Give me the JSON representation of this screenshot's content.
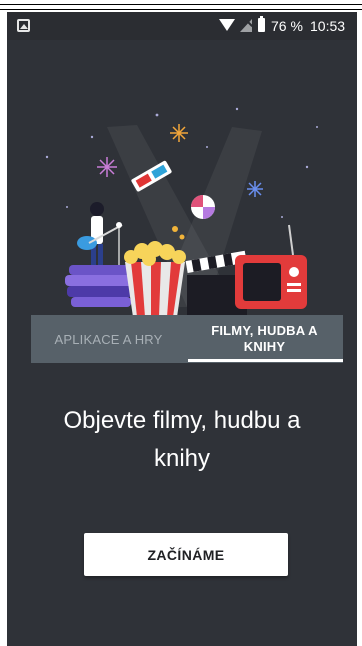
{
  "status_bar": {
    "battery_percent": "76 %",
    "time": "10:53",
    "icons": [
      "gallery-icon",
      "wifi-icon",
      "no-signal-icon",
      "battery-icon"
    ]
  },
  "tabs": [
    {
      "label": "APLIKACE A HRY",
      "selected": false
    },
    {
      "label": "FILMY, HUDBA A KNIHY",
      "selected": true
    }
  ],
  "headline": "Objevte filmy, hudbu a knihy",
  "cta_label": "ZAČÍNÁME",
  "colors": {
    "background": "#2f3238",
    "tab_bar": "#576169",
    "button": "#ffffff"
  }
}
